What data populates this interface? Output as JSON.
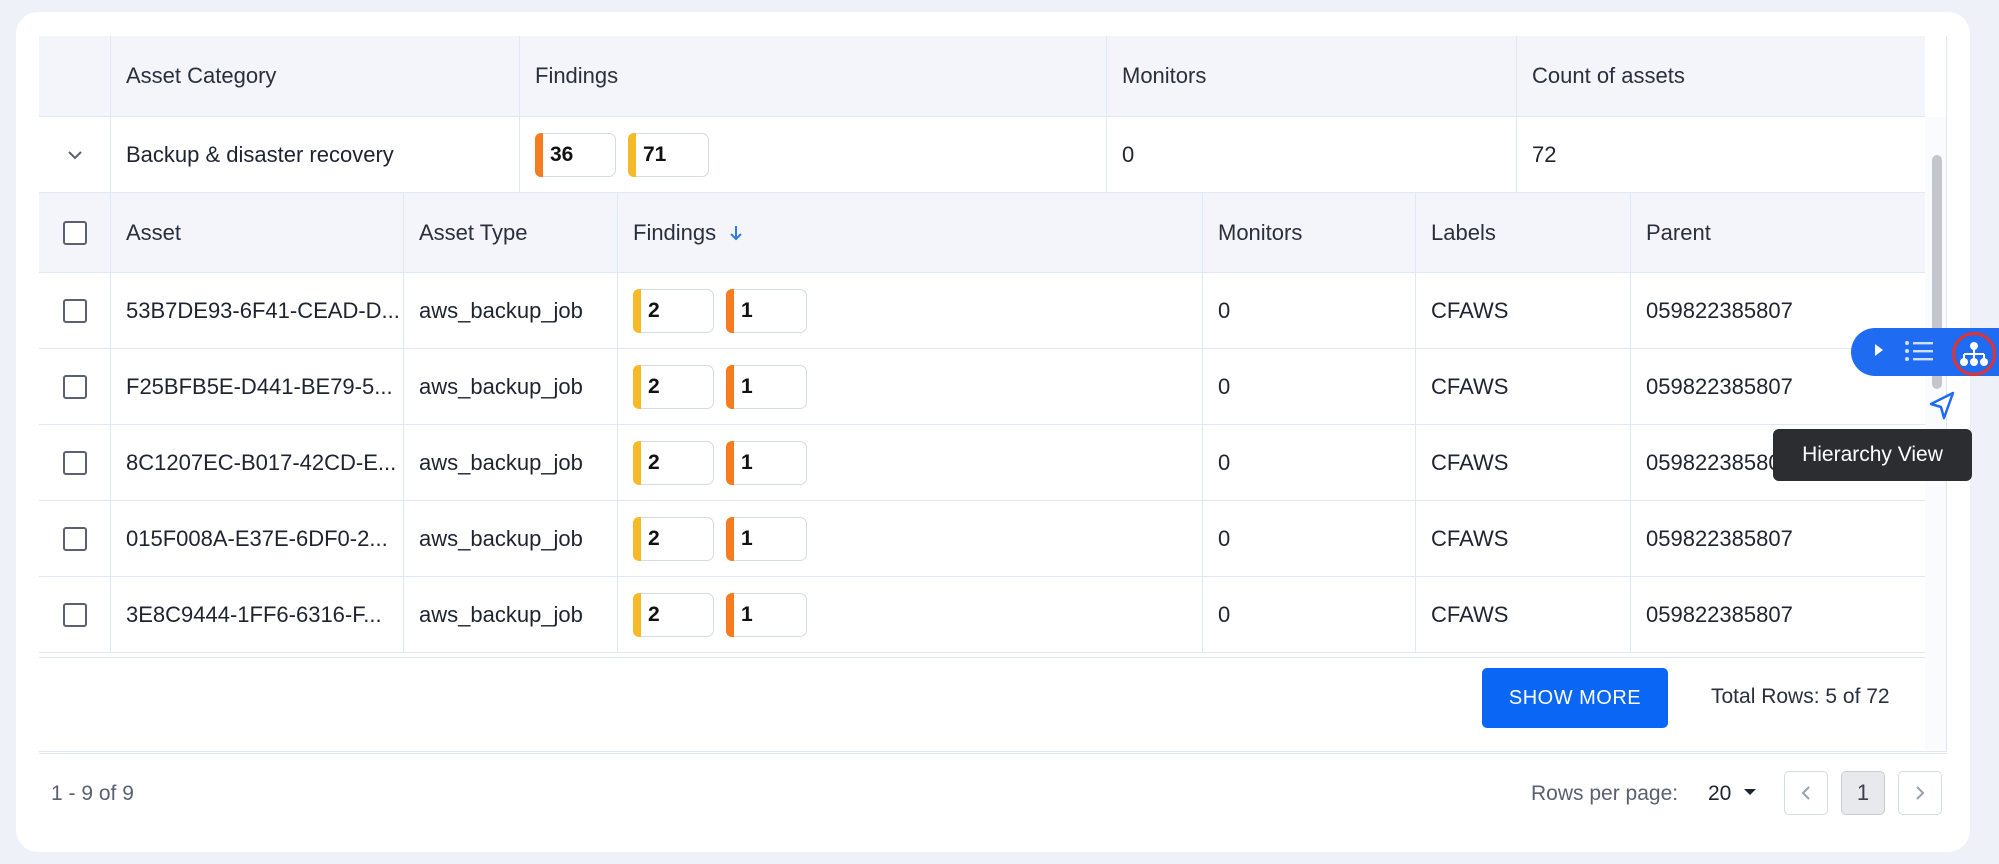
{
  "outer_table": {
    "headers": [
      "Asset Category",
      "Findings",
      "Monitors",
      "Count of assets"
    ],
    "row": {
      "category": "Backup & disaster recovery",
      "findings": [
        {
          "value": "36",
          "color": "#f57c1f"
        },
        {
          "value": "71",
          "color": "#f6b928"
        }
      ],
      "monitors": "0",
      "count": "72"
    }
  },
  "inner_table": {
    "headers": [
      "Asset",
      "Asset Type",
      "Findings",
      "Monitors",
      "Labels",
      "Parent"
    ],
    "sort_icon": "arrow-down-icon",
    "rows": [
      {
        "asset": "53B7DE93-6F41-CEAD-D...",
        "type": "aws_backup_job",
        "f1": "2",
        "f2": "1",
        "monitors": "0",
        "labels": "CFAWS",
        "parent": "059822385807"
      },
      {
        "asset": "F25BFB5E-D441-BE79-5...",
        "type": "aws_backup_job",
        "f1": "2",
        "f2": "1",
        "monitors": "0",
        "labels": "CFAWS",
        "parent": "059822385807"
      },
      {
        "asset": "8C1207EC-B017-42CD-E...",
        "type": "aws_backup_job",
        "f1": "2",
        "f2": "1",
        "monitors": "0",
        "labels": "CFAWS",
        "parent": "059822385807"
      },
      {
        "asset": "015F008A-E37E-6DF0-2...",
        "type": "aws_backup_job",
        "f1": "2",
        "f2": "1",
        "monitors": "0",
        "labels": "CFAWS",
        "parent": "059822385807"
      },
      {
        "asset": "3E8C9444-1FF6-6316-F...",
        "type": "aws_backup_job",
        "f1": "2",
        "f2": "1",
        "monitors": "0",
        "labels": "CFAWS",
        "parent": "059822385807"
      }
    ],
    "badge_colors": {
      "first": "#f6b928",
      "second": "#f57c1f"
    },
    "show_more_label": "SHOW MORE",
    "total_rows": "Total Rows: 5 of 72"
  },
  "pagination": {
    "range": "1 - 9 of 9",
    "rows_per_page_label": "Rows per page:",
    "rows_per_page_value": "20",
    "current_page": "1"
  },
  "floating_toolbar": {
    "icons": [
      "play-icon",
      "list-icon",
      "hierarchy-icon"
    ],
    "tooltip": "Hierarchy View",
    "accent": "#1f6bf2",
    "highlight": "#e5322d"
  }
}
